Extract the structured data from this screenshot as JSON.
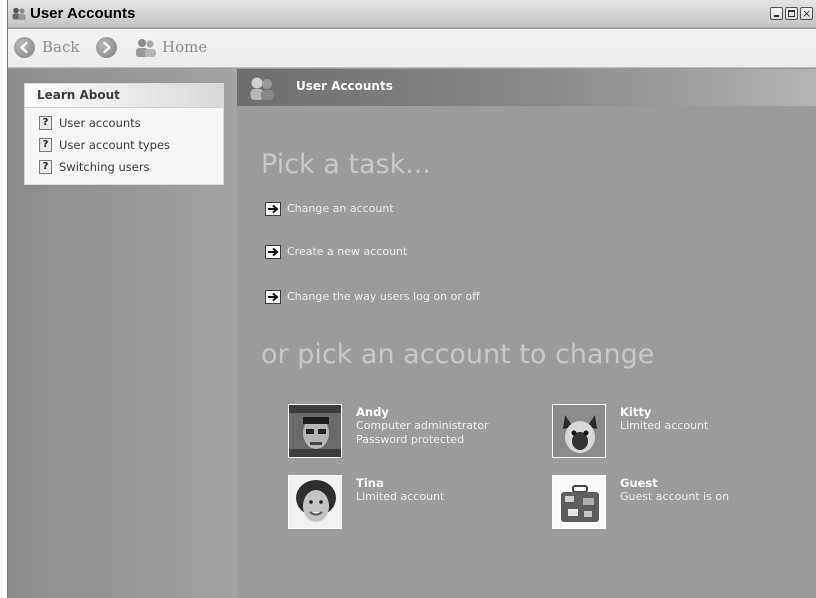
{
  "window": {
    "title": "User Accounts",
    "controls": {
      "minimize": "minimize",
      "maximize": "maximize",
      "close": "×"
    }
  },
  "toolbar": {
    "back_label": "Back",
    "forward_label": "",
    "home_label": "Home"
  },
  "sidebar": {
    "header": "Learn About",
    "items": [
      {
        "label": "User accounts",
        "icon": "help-icon"
      },
      {
        "label": "User account types",
        "icon": "help-icon"
      },
      {
        "label": "Switching users",
        "icon": "help-icon"
      }
    ]
  },
  "main": {
    "header_title": "User Accounts",
    "task_heading": "Pick a task...",
    "tasks": [
      {
        "label": "Change an account",
        "icon": "arrow-icon"
      },
      {
        "label": "Create a new account",
        "icon": "arrow-icon"
      },
      {
        "label": "Change the way users log on or off",
        "icon": "arrow-icon"
      }
    ],
    "account_heading": "or pick an account to change",
    "accounts": [
      {
        "name": "Andy",
        "lines": [
          "Computer administrator",
          "Password protected"
        ],
        "avatar": "man-photo"
      },
      {
        "name": "Kitty",
        "lines": [
          "Limited account"
        ],
        "avatar": "cat-photo"
      },
      {
        "name": "Tina",
        "lines": [
          "Limited account"
        ],
        "avatar": "woman-photo"
      },
      {
        "name": "Guest",
        "lines": [
          "Guest account is on"
        ],
        "avatar": "suitcase-picture"
      }
    ]
  },
  "colors": {
    "title_bar": "#d4d4d4",
    "pane_background": "#9c9c9c",
    "sidebar_background": "#959595",
    "heading_text": "#c8c8c8",
    "link_text": "#ececec"
  }
}
